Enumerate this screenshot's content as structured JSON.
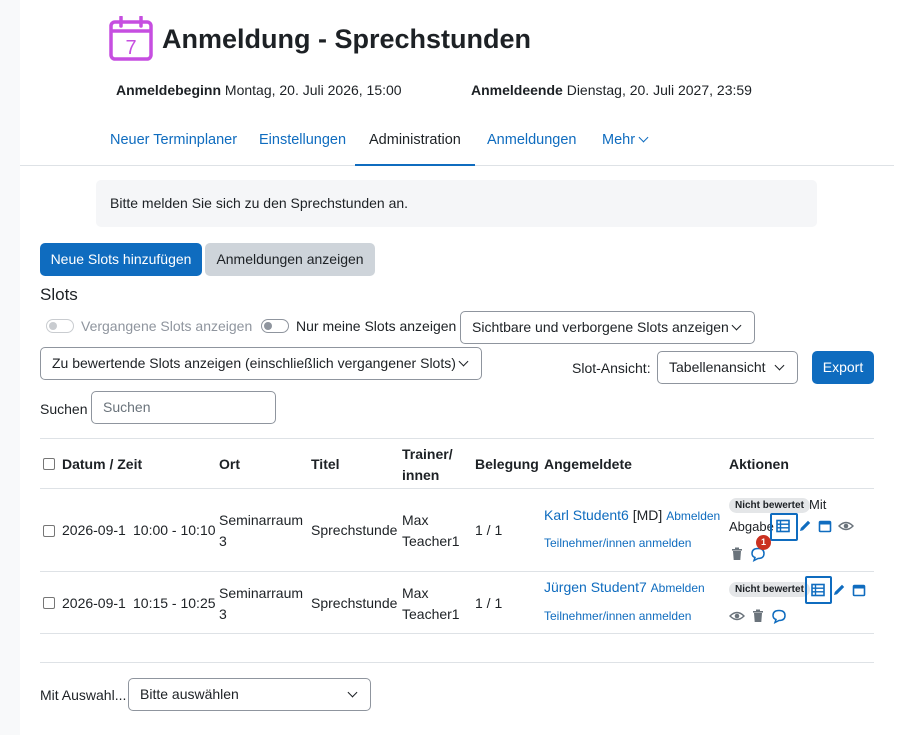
{
  "header": {
    "title": "Anmeldung - Sprechstunden",
    "calendar_day": "7",
    "start_label": "Anmeldebeginn",
    "start_value": "Montag, 20. Juli 2026, 15:00",
    "end_label": "Anmeldeende",
    "end_value": "Dienstag, 20. Juli 2027, 23:59"
  },
  "nav": {
    "tabs": [
      {
        "label": "Neuer Terminplaner"
      },
      {
        "label": "Einstellungen"
      },
      {
        "label": "Administration"
      },
      {
        "label": "Anmeldungen"
      },
      {
        "label": "Mehr"
      }
    ]
  },
  "intro": {
    "text": "Bitte melden Sie sich zu den Sprechstunden an."
  },
  "buttons": {
    "add_slots": "Neue Slots hinzufügen",
    "show_bookings": "Anmeldungen anzeigen",
    "export": "Export"
  },
  "slots": {
    "title": "Slots",
    "toggle_past": "Vergangene Slots anzeigen",
    "toggle_mine": "Nur meine Slots anzeigen",
    "visibility_select": "Sichtbare und verborgene Slots anzeigen",
    "grading_select": "Zu bewertende Slots anzeigen (einschließlich vergangener Slots)",
    "view_label": "Slot-Ansicht:",
    "view_select": "Tabellenansicht",
    "search_label": "Suchen",
    "search_placeholder": "Suchen"
  },
  "table": {
    "headers": {
      "datetime": "Datum / Zeit",
      "location": "Ort",
      "title": "Titel",
      "trainer_1": "Trainer/",
      "trainer_2": "innen",
      "booking": "Belegung",
      "registered": "Angemeldete",
      "actions": "Aktionen"
    },
    "rows": [
      {
        "date": "2026-09-1",
        "time": "10:00 - 10:10",
        "location_1": "Seminarraum",
        "location_2": "3",
        "title": "Sprechstunde",
        "trainer_1": "Max",
        "trainer_2": "Teacher1",
        "booking": "1 / 1",
        "student": "Karl Student6",
        "student_tag": "[MD]",
        "cancel": "Abmelden",
        "enroll": "Teilnehmer/innen anmelden",
        "grade_badge": "Nicht bewertet",
        "grade_text_1": "Mit",
        "grade_text_2": "Abgabe",
        "notifications": "1"
      },
      {
        "date": "2026-09-1",
        "time": "10:15 - 10:25",
        "location_1": "Seminarraum",
        "location_2": "3",
        "title": "Sprechstunde",
        "trainer_1": "Max",
        "trainer_2": "Teacher1",
        "booking": "1 / 1",
        "student": "Jürgen Student7",
        "cancel": "Abmelden",
        "enroll": "Teilnehmer/innen anmelden",
        "grade_badge": "Nicht bewertet"
      }
    ]
  },
  "bulk": {
    "label": "Mit Auswahl...",
    "select": "Bitte auswählen"
  },
  "colors": {
    "primary": "#0f6cbf",
    "accent_purple": "#c64ee0",
    "notification_red": "#ca3120"
  }
}
